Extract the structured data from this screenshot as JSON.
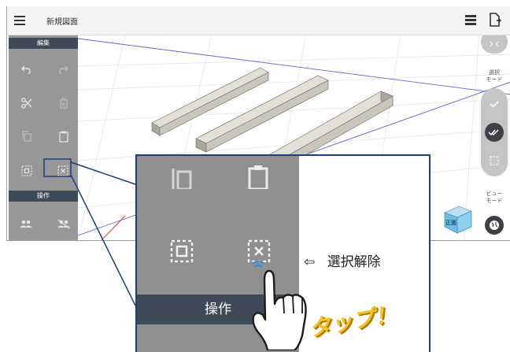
{
  "topbar": {
    "title": "新規図面",
    "menu_icon": "hamburger-menu-icon",
    "list_icon": "list-view-icon",
    "export_icon": "document-export-icon"
  },
  "left_panel": {
    "edit_header": "編集",
    "operation_header": "操作",
    "tools": [
      "undo-icon",
      "redo-icon",
      "cut-icon",
      "delete-icon",
      "copy-icon",
      "paste-icon",
      "select-all-icon",
      "deselect-icon",
      "group-icon",
      "ungroup-icon"
    ]
  },
  "right_panel": {
    "select_mode_label": "選択\nモード",
    "view_mode_label": "ビュー\nモード",
    "view_cube_label": "正面"
  },
  "callout": {
    "operation_header": "操作",
    "annotation_arrow": "⇦",
    "annotation_text": "選択解除",
    "tap_label": "タップ！"
  },
  "colors": {
    "panel_gray": "#808080",
    "header_dark": "#3f4a59",
    "callout_border": "#1a3f7a",
    "tap_yellow": "#f7c31e",
    "beam_fill": "#cdcbc0"
  }
}
